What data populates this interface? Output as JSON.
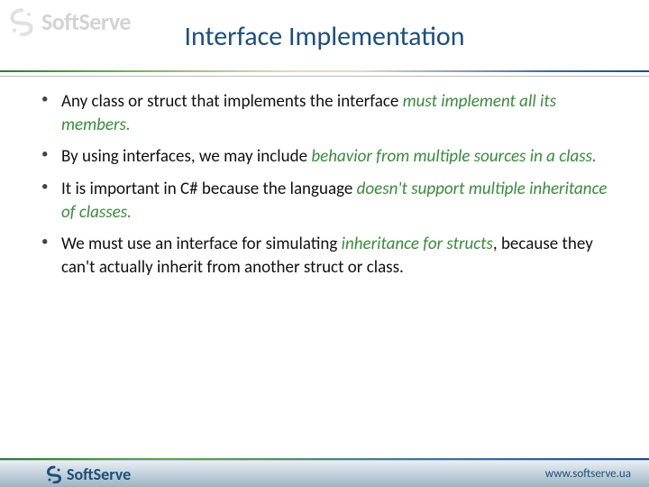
{
  "brand": {
    "name": "SoftServe",
    "url": "www.softserve.ua"
  },
  "title": "Interface Implementation",
  "bullets": [
    {
      "plain1": "Any class or struct that implements the interface ",
      "em": "must implement all its members.",
      "plain2": ""
    },
    {
      "plain1": "By using interfaces, we may include ",
      "em": "behavior from multiple sources in a class.",
      "plain2": ""
    },
    {
      "plain1": "It is important in C# because the language ",
      "em": "doesn't support multiple inheritance of classes.",
      "plain2": ""
    },
    {
      "plain1": "We must use an interface for simulating ",
      "em": "inheritance for structs",
      "plain2": ", because they can't actually inherit from another struct or class."
    }
  ]
}
